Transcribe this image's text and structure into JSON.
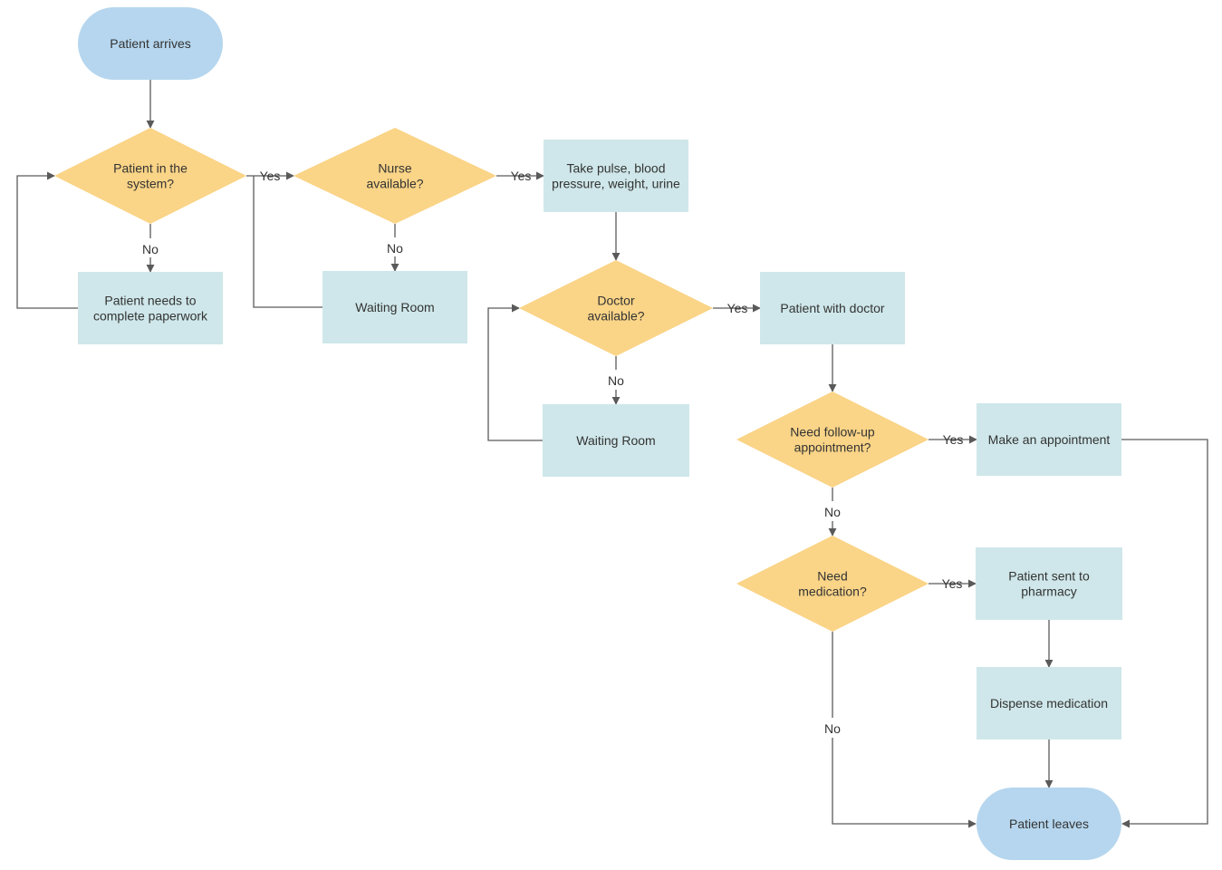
{
  "diagram": {
    "type": "flowchart",
    "colors": {
      "terminal_fill": "#b5d6ee",
      "decision_fill": "#fad487",
      "process_fill": "#cfe7ea",
      "edge": "#5a5a5a",
      "text": "#333333"
    },
    "nodes": [
      {
        "id": "arrives",
        "shape": "terminal",
        "lines": [
          "Patient arrives"
        ]
      },
      {
        "id": "in_system",
        "shape": "decision",
        "lines": [
          "Patient in the",
          "system?"
        ]
      },
      {
        "id": "paperwork",
        "shape": "process",
        "lines": [
          "Patient needs to",
          "complete paperwork"
        ]
      },
      {
        "id": "nurse",
        "shape": "decision",
        "lines": [
          "Nurse",
          "available?"
        ]
      },
      {
        "id": "waiting1",
        "shape": "process",
        "lines": [
          "Waiting Room"
        ]
      },
      {
        "id": "vitals",
        "shape": "process",
        "lines": [
          "Take pulse, blood",
          "pressure, weight, urine"
        ]
      },
      {
        "id": "doctor",
        "shape": "decision",
        "lines": [
          "Doctor",
          "available?"
        ]
      },
      {
        "id": "waiting2",
        "shape": "process",
        "lines": [
          "Waiting Room"
        ]
      },
      {
        "id": "with_doctor",
        "shape": "process",
        "lines": [
          "Patient with doctor"
        ]
      },
      {
        "id": "followup",
        "shape": "decision",
        "lines": [
          "Need follow-up",
          "appointment?"
        ]
      },
      {
        "id": "appointment",
        "shape": "process",
        "lines": [
          "Make an appointment"
        ]
      },
      {
        "id": "medication",
        "shape": "decision",
        "lines": [
          "Need",
          "medication?"
        ]
      },
      {
        "id": "pharmacy",
        "shape": "process",
        "lines": [
          "Patient sent to",
          "pharmacy"
        ]
      },
      {
        "id": "dispense",
        "shape": "process",
        "lines": [
          "Dispense medication"
        ]
      },
      {
        "id": "leaves",
        "shape": "terminal",
        "lines": [
          "Patient leaves"
        ]
      }
    ],
    "edges": [
      {
        "from": "arrives",
        "to": "in_system",
        "label": ""
      },
      {
        "from": "in_system",
        "to": "nurse",
        "label": "Yes"
      },
      {
        "from": "in_system",
        "to": "paperwork",
        "label": "No"
      },
      {
        "from": "paperwork",
        "to": "in_system",
        "label": ""
      },
      {
        "from": "nurse",
        "to": "vitals",
        "label": "Yes"
      },
      {
        "from": "nurse",
        "to": "waiting1",
        "label": "No"
      },
      {
        "from": "waiting1",
        "to": "nurse",
        "label": ""
      },
      {
        "from": "vitals",
        "to": "doctor",
        "label": ""
      },
      {
        "from": "doctor",
        "to": "with_doctor",
        "label": "Yes"
      },
      {
        "from": "doctor",
        "to": "waiting2",
        "label": "No"
      },
      {
        "from": "waiting2",
        "to": "doctor",
        "label": ""
      },
      {
        "from": "with_doctor",
        "to": "followup",
        "label": ""
      },
      {
        "from": "followup",
        "to": "appointment",
        "label": "Yes"
      },
      {
        "from": "followup",
        "to": "medication",
        "label": "No"
      },
      {
        "from": "appointment",
        "to": "leaves",
        "label": ""
      },
      {
        "from": "medication",
        "to": "pharmacy",
        "label": "Yes"
      },
      {
        "from": "medication",
        "to": "leaves",
        "label": "No"
      },
      {
        "from": "pharmacy",
        "to": "dispense",
        "label": ""
      },
      {
        "from": "dispense",
        "to": "leaves",
        "label": ""
      }
    ]
  }
}
